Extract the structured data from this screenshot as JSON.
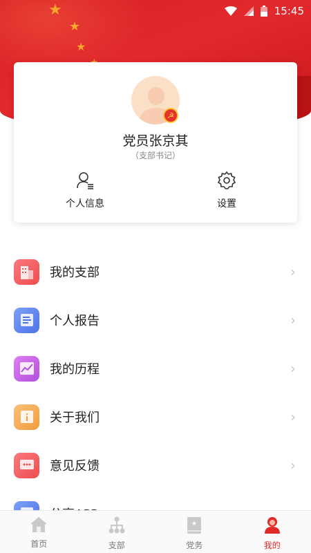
{
  "status_bar": {
    "time": "15:45",
    "icons": [
      "wifi-icon",
      "signal-icon",
      "battery-icon"
    ]
  },
  "profile": {
    "name": "党员张京其",
    "role": "（支部书记）",
    "badge_icon": "party-emblem-icon",
    "actions": [
      {
        "label": "个人信息",
        "icon": "person-info-icon"
      },
      {
        "label": "设置",
        "icon": "gear-icon"
      }
    ]
  },
  "menu": {
    "items": [
      {
        "label": "我的支部",
        "icon": "building-icon",
        "color": "#f0575a"
      },
      {
        "label": "个人报告",
        "icon": "report-icon",
        "color": "#5f85f0"
      },
      {
        "label": "我的历程",
        "icon": "chart-icon",
        "color": "#c75de6"
      },
      {
        "label": "关于我们",
        "icon": "info-icon",
        "color": "#f5a74c"
      },
      {
        "label": "意见反馈",
        "icon": "feedback-icon",
        "color": "#f0575a"
      },
      {
        "label": "分享APP",
        "icon": "share-icon",
        "color": "#5f85f0"
      }
    ]
  },
  "bottom_nav": {
    "items": [
      {
        "label": "首页",
        "icon": "home-icon"
      },
      {
        "label": "支部",
        "icon": "org-tree-icon"
      },
      {
        "label": "党务",
        "icon": "party-book-icon"
      },
      {
        "label": "我的",
        "icon": "user-icon",
        "active": true
      }
    ]
  },
  "colors": {
    "brand_red": "#e02a28",
    "gold": "#f7b52b"
  }
}
